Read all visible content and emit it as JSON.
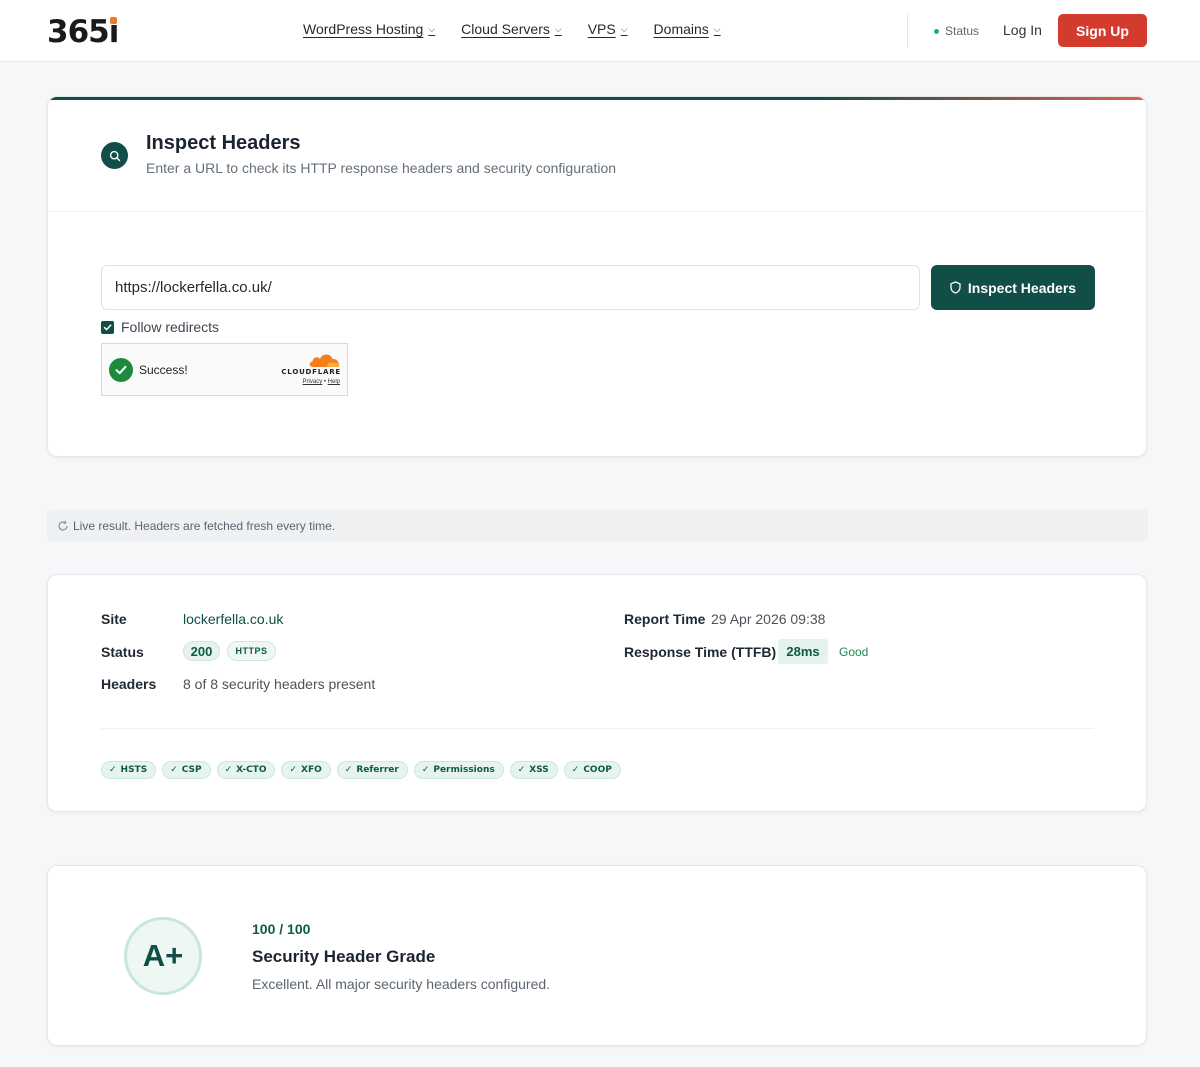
{
  "header": {
    "logo_text": "365",
    "logo_suffix": "i",
    "nav": [
      {
        "label": "WordPress Hosting"
      },
      {
        "label": "Cloud Servers"
      },
      {
        "label": "VPS"
      },
      {
        "label": "Domains"
      }
    ],
    "status_label": "Status",
    "login_label": "Log In",
    "signup_label": "Sign Up"
  },
  "inspect": {
    "title": "Inspect Headers",
    "subtitle": "Enter a URL to check its HTTP response headers and security configuration",
    "url_value": "https://lockerfella.co.uk/",
    "button_label": "Inspect Headers",
    "follow_redirects_label": "Follow redirects",
    "follow_redirects_checked": true,
    "captcha": {
      "status": "Success!",
      "brand": "CLOUDFLARE",
      "privacy": "Privacy",
      "separator": "•",
      "help": "Help"
    }
  },
  "live_notice": "Live result. Headers are fetched fresh every time.",
  "summary": {
    "site_label": "Site",
    "site_value": "lockerfella.co.uk",
    "status_label": "Status",
    "status_code": "200",
    "protocol": "HTTPS",
    "headers_label": "Headers",
    "headers_value": "8 of 8 security headers present",
    "report_time_label": "Report Time",
    "report_time_value": "29 Apr 2026 09:38",
    "ttfb_label": "Response Time (TTFB)",
    "ttfb_value": "28ms",
    "ttfb_rating": "Good",
    "header_tags": [
      "HSTS",
      "CSP",
      "X-CTO",
      "XFO",
      "Referrer",
      "Permissions",
      "XSS",
      "COOP"
    ]
  },
  "grade": {
    "letter": "A+",
    "score": "100 / 100",
    "title": "Security Header Grade",
    "description": "Excellent. All major security headers configured."
  },
  "colors": {
    "brand_green": "#104e47",
    "signup_red": "#d33b2f",
    "logo_accent": "#f07b22"
  }
}
